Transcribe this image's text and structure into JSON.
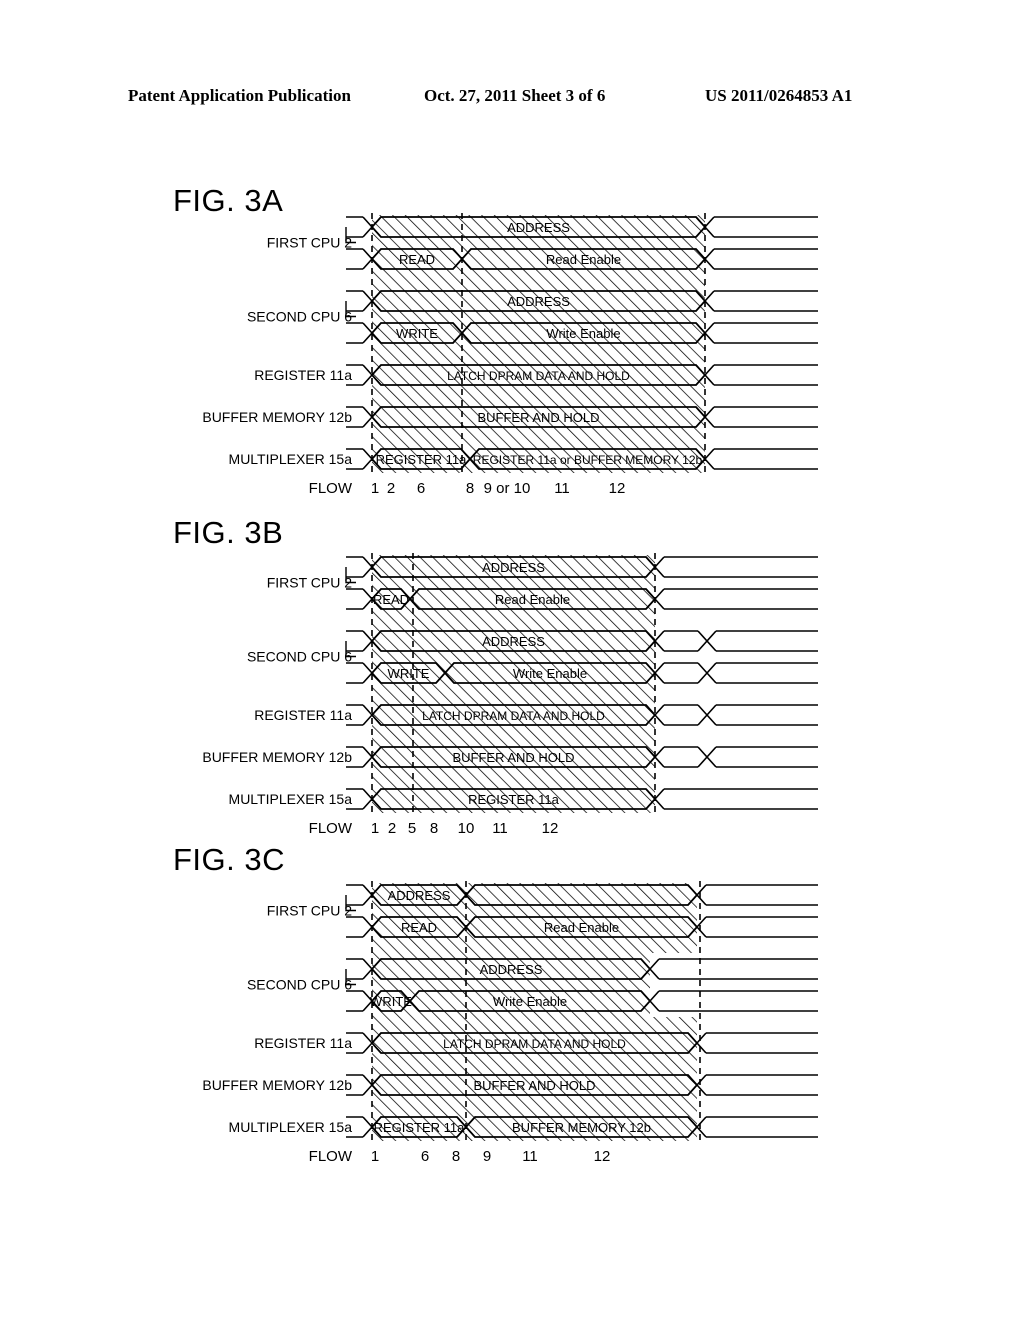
{
  "header": {
    "publication": "Patent Application Publication",
    "date_sheet": "Oct. 27, 2011   Sheet 3 of 6",
    "patent_number": "US 2011/0264853 A1"
  },
  "figures": [
    {
      "id": "fig-3a",
      "title": "FIG. 3A",
      "flow_label": "FLOW",
      "flow_numbers": [
        "1",
        "2",
        "6",
        "8",
        "9 or 10",
        "11",
        "12"
      ],
      "rows": [
        {
          "label": "FIRST CPU 2",
          "signal": "address",
          "segments": [
            {
              "text": "ADDRESS"
            }
          ]
        },
        {
          "label": "",
          "signal": "read",
          "segments": [
            {
              "text": "READ"
            },
            {
              "text": "Read Enable"
            }
          ]
        },
        {
          "label": "SECOND CPU 6",
          "signal": "address",
          "segments": [
            {
              "text": "ADDRESS"
            }
          ]
        },
        {
          "label": "",
          "signal": "write",
          "segments": [
            {
              "text": "WRITE"
            },
            {
              "text": "Write Enable"
            }
          ]
        },
        {
          "label": "REGISTER 11a",
          "signal": "register",
          "segments": [
            {
              "text": "LATCH DPRAM DATA AND HOLD"
            }
          ]
        },
        {
          "label": "BUFFER MEMORY 12b",
          "signal": "buffer",
          "segments": [
            {
              "text": "BUFFER AND HOLD"
            }
          ]
        },
        {
          "label": "MULTIPLEXER 15a",
          "signal": "multiplexer",
          "segments": [
            {
              "text": "REGISTER 11a"
            },
            {
              "text": "REGISTER 11a or BUFFER MEMORY 12b"
            }
          ]
        }
      ]
    },
    {
      "id": "fig-3b",
      "title": "FIG. 3B",
      "flow_label": "FLOW",
      "flow_numbers": [
        "1",
        "2",
        "5",
        "8",
        "10",
        "11",
        "12"
      ],
      "rows": [
        {
          "label": "FIRST CPU 2",
          "signal": "address",
          "segments": [
            {
              "text": "ADDRESS"
            }
          ]
        },
        {
          "label": "",
          "signal": "read",
          "segments": [
            {
              "text": "READ"
            },
            {
              "text": "Read Enable"
            }
          ]
        },
        {
          "label": "SECOND CPU 6",
          "signal": "address",
          "segments": [
            {
              "text": "ADDRESS"
            }
          ]
        },
        {
          "label": "",
          "signal": "write",
          "segments": [
            {
              "text": "WRITE"
            },
            {
              "text": "Write Enable"
            }
          ]
        },
        {
          "label": "REGISTER 11a",
          "signal": "register",
          "segments": [
            {
              "text": "LATCH DPRAM DATA AND HOLD"
            }
          ]
        },
        {
          "label": "BUFFER MEMORY 12b",
          "signal": "buffer",
          "segments": [
            {
              "text": "BUFFER AND HOLD"
            }
          ]
        },
        {
          "label": "MULTIPLEXER 15a",
          "signal": "multiplexer",
          "segments": [
            {
              "text": "REGISTER 11a"
            }
          ]
        }
      ]
    },
    {
      "id": "fig-3c",
      "title": "FIG. 3C",
      "flow_label": "FLOW",
      "flow_numbers": [
        "1",
        "6",
        "8",
        "9",
        "11",
        "12"
      ],
      "rows": [
        {
          "label": "FIRST CPU 2",
          "signal": "address",
          "segments": [
            {
              "text": "ADDRESS"
            }
          ]
        },
        {
          "label": "",
          "signal": "read",
          "segments": [
            {
              "text": "READ"
            },
            {
              "text": "Read Enable"
            }
          ]
        },
        {
          "label": "SECOND CPU 6",
          "signal": "address",
          "segments": [
            {
              "text": "ADDRESS"
            }
          ]
        },
        {
          "label": "",
          "signal": "write",
          "segments": [
            {
              "text": "WRITE"
            },
            {
              "text": "Write Enable"
            }
          ]
        },
        {
          "label": "REGISTER 11a",
          "signal": "register",
          "segments": [
            {
              "text": "LATCH DPRAM DATA AND HOLD"
            }
          ]
        },
        {
          "label": "BUFFER MEMORY 12b",
          "signal": "buffer",
          "segments": [
            {
              "text": "BUFFER AND HOLD"
            }
          ]
        },
        {
          "label": "MULTIPLEXER 15a",
          "signal": "multiplexer",
          "segments": [
            {
              "text": "REGISTER 11a"
            },
            {
              "text": "BUFFER MEMORY 12b"
            }
          ]
        }
      ]
    }
  ],
  "colors": {
    "ink": "#000000",
    "paper": "#ffffff"
  }
}
